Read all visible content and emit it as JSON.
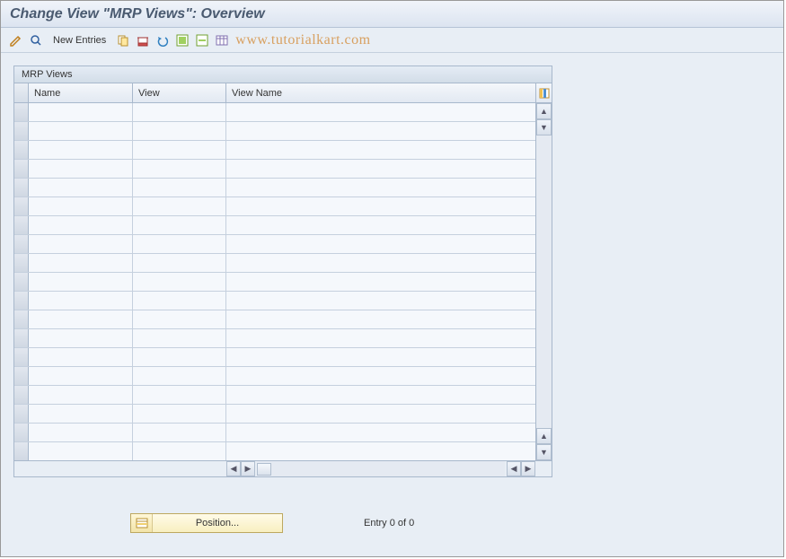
{
  "title": "Change View \"MRP Views\": Overview",
  "toolbar": {
    "new_entries": "New Entries"
  },
  "watermark": "www.tutorialkart.com",
  "panel": {
    "title": "MRP Views",
    "columns": {
      "name": "Name",
      "view": "View",
      "viewname": "View Name"
    }
  },
  "footer": {
    "position_label": "Position...",
    "entry_status": "Entry 0 of 0"
  }
}
